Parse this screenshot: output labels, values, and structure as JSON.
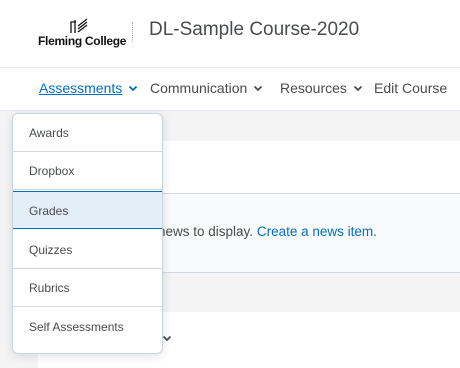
{
  "header": {
    "logo_text": "Fleming College",
    "course_title": "DL-Sample Course-2020"
  },
  "nav": {
    "items": [
      {
        "label": "Assessments"
      },
      {
        "label": "Communication"
      },
      {
        "label": "Resources"
      },
      {
        "label": "Edit Course"
      }
    ]
  },
  "dropdown": {
    "items": [
      {
        "label": "Awards"
      },
      {
        "label": "Dropbox"
      },
      {
        "label": "Grades"
      },
      {
        "label": "Quizzes"
      },
      {
        "label": "Rubrics"
      },
      {
        "label": "Self Assessments"
      }
    ],
    "active": "Grades"
  },
  "news": {
    "text": "news to display.",
    "link": "Create a news item."
  },
  "colors": {
    "link": "#006fbf",
    "active_bg": "#e3eff7"
  }
}
